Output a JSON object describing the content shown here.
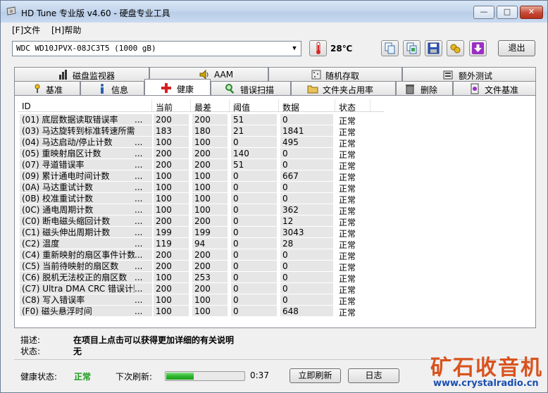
{
  "window": {
    "title": "HD Tune 专业版 v4.60 - 硬盘专业工具",
    "controls": {
      "minimize": "—",
      "maximize": "□",
      "close": "✕"
    }
  },
  "menu": [
    {
      "label": "[F]文件"
    },
    {
      "label": "[H]帮助"
    }
  ],
  "toolbar": {
    "drive": "WDC WD10JPVX-08JC3T5 (1000 gB)",
    "temperature": "28℃",
    "exit_label": "退出",
    "icons": [
      "copy-icon",
      "copy-all-icon",
      "save-icon",
      "options-icon",
      "download-icon"
    ]
  },
  "tabs": {
    "row1": [
      {
        "label": "磁盘监视器",
        "icon": "bar-chart-icon"
      },
      {
        "label": "AAM",
        "icon": "speaker-icon"
      },
      {
        "label": "随机存取",
        "icon": "random-access-icon"
      },
      {
        "label": "额外测试",
        "icon": "extra-tests-icon"
      }
    ],
    "row2": [
      {
        "label": "基准",
        "icon": "benchmark-icon"
      },
      {
        "label": "信息",
        "icon": "info-icon"
      },
      {
        "label": "健康",
        "icon": "health-cross-icon"
      },
      {
        "label": "错误扫描",
        "icon": "magnifier-icon"
      },
      {
        "label": "文件夹占用率",
        "icon": "folder-icon"
      },
      {
        "label": "删除",
        "icon": "trash-icon"
      },
      {
        "label": "文件基准",
        "icon": "file-benchmark-icon"
      }
    ],
    "active": "健康"
  },
  "table": {
    "columns": [
      "ID",
      "当前",
      "最差",
      "阈值",
      "数据",
      "状态"
    ],
    "rows": [
      [
        "(01) 底层数据读取错误率",
        "...",
        "200",
        "200",
        "51",
        "0",
        "正常"
      ],
      [
        "(03) 马达旋转到标准转速所需...",
        "",
        "183",
        "180",
        "21",
        "1841",
        "正常"
      ],
      [
        "(04) 马达启动/停止计数",
        "...",
        "100",
        "100",
        "0",
        "495",
        "正常"
      ],
      [
        "(05) 重映射扇区计数",
        "...",
        "200",
        "200",
        "140",
        "0",
        "正常"
      ],
      [
        "(07) 寻道错误率",
        "...",
        "200",
        "200",
        "51",
        "0",
        "正常"
      ],
      [
        "(09) 累计通电时间计数",
        "...",
        "100",
        "100",
        "0",
        "667",
        "正常"
      ],
      [
        "(0A) 马达重试计数",
        "...",
        "100",
        "100",
        "0",
        "0",
        "正常"
      ],
      [
        "(0B) 校准重试计数",
        "...",
        "100",
        "100",
        "0",
        "0",
        "正常"
      ],
      [
        "(0C) 通电周期计数",
        "...",
        "100",
        "100",
        "0",
        "362",
        "正常"
      ],
      [
        "(C0) 断电磁头缩回计数",
        "...",
        "200",
        "200",
        "0",
        "12",
        "正常"
      ],
      [
        "(C1) 磁头伸出周期计数",
        "...",
        "199",
        "199",
        "0",
        "3043",
        "正常"
      ],
      [
        "(C2) 温度",
        "...",
        "119",
        "94",
        "0",
        "28",
        "正常"
      ],
      [
        "(C4) 重新映射的扇区事件计数",
        "...",
        "200",
        "200",
        "0",
        "0",
        "正常"
      ],
      [
        "(C5) 当前待映射的扇区数",
        "...",
        "200",
        "200",
        "0",
        "0",
        "正常"
      ],
      [
        "(C6) 脱机无法校正的扇区数",
        "...",
        "100",
        "253",
        "0",
        "0",
        "正常"
      ],
      [
        "(C7) Ultra DMA CRC 错误计数",
        "...",
        "200",
        "200",
        "0",
        "0",
        "正常"
      ],
      [
        "(C8) 写入错误率",
        "...",
        "100",
        "100",
        "0",
        "0",
        "正常"
      ],
      [
        "(F0) 磁头悬浮时间",
        "...",
        "100",
        "100",
        "0",
        "648",
        "正常"
      ]
    ]
  },
  "details": {
    "desc_label": "描述:",
    "desc_value": "在项目上点击可以获得更加详细的有关说明",
    "state_label": "状态:",
    "state_value": "无"
  },
  "footer": {
    "health_label": "健康状态:",
    "health_value": "正常",
    "refresh_label": "下次刷新:",
    "refresh_progress": 0.35,
    "refresh_time": "0:37",
    "refresh_now": "立即刷新",
    "log": "日志"
  },
  "watermark": {
    "title": "矿石收音机",
    "url": "www.crystalradio.cn"
  }
}
